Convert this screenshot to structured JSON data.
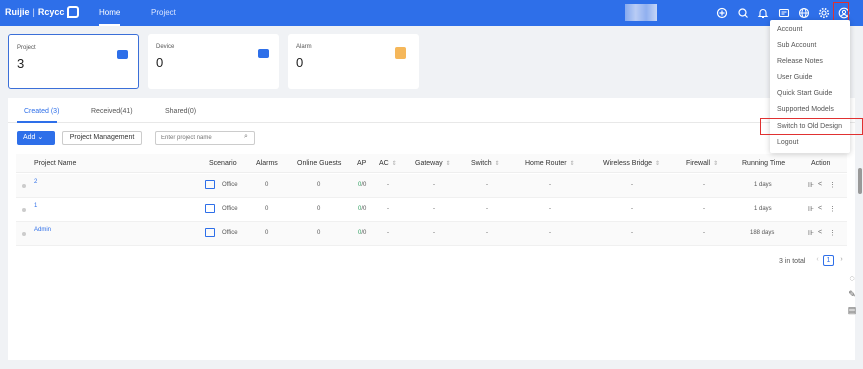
{
  "header": {
    "logo_brand": "Ruijie",
    "logo_sep": "|",
    "logo_product": "Rcycc",
    "nav": [
      "Home",
      "Project"
    ],
    "icons": [
      "plus-circle-icon",
      "search-icon",
      "bell-icon",
      "message-icon",
      "globe-icon",
      "gear-icon",
      "user-icon"
    ]
  },
  "cards": [
    {
      "label": "Project",
      "value": "3",
      "icon": "folder-icon",
      "color": "#2e6fe9"
    },
    {
      "label": "Device",
      "value": "0",
      "icon": "device-icon",
      "color": "#2e6fe9"
    },
    {
      "label": "Alarm",
      "value": "0",
      "icon": "alarm-icon",
      "color": "#f5a623"
    }
  ],
  "tabs": [
    "Created (3)",
    "Received(41)",
    "Shared(0)"
  ],
  "toolbar": {
    "add_label": "Add",
    "pm_label": "Project Management",
    "search_placeholder": "Enter project name"
  },
  "columns": [
    "Project Name",
    "Scenario",
    "Alarms",
    "Online Guests",
    "AP",
    "AC",
    "Gateway",
    "Switch",
    "Home Router",
    "Wireless Bridge",
    "Firewall",
    "Running Time",
    "Action"
  ],
  "rows": [
    {
      "name": "2",
      "scenario": "Office",
      "alarms": "0",
      "guests": "0",
      "ap_on": "0",
      "ap_total": "/0",
      "ac": "-",
      "gateway": "-",
      "switch": "-",
      "router": "-",
      "bridge": "-",
      "firewall": "-",
      "time": "1 days"
    },
    {
      "name": "1",
      "scenario": "Office",
      "alarms": "0",
      "guests": "0",
      "ap_on": "0",
      "ap_total": "/0",
      "ac": "-",
      "gateway": "-",
      "switch": "-",
      "router": "-",
      "bridge": "-",
      "firewall": "-",
      "time": "1 days"
    },
    {
      "name": "Admin",
      "scenario": "Office",
      "alarms": "0",
      "guests": "0",
      "ap_on": "0",
      "ap_total": "/0",
      "ac": "-",
      "gateway": "-",
      "switch": "-",
      "router": "-",
      "bridge": "-",
      "firewall": "-",
      "time": "188 days"
    }
  ],
  "pagination": {
    "total": "3 in total",
    "page": "1"
  },
  "user_menu": [
    "Account",
    "Sub Account",
    "Release Notes",
    "User Guide",
    "Quick Start Guide",
    "Supported Models",
    "Switch to Old Design",
    "Logout"
  ],
  "colors": {
    "accent": "#2e6fe9",
    "highlight": "#e03131"
  }
}
